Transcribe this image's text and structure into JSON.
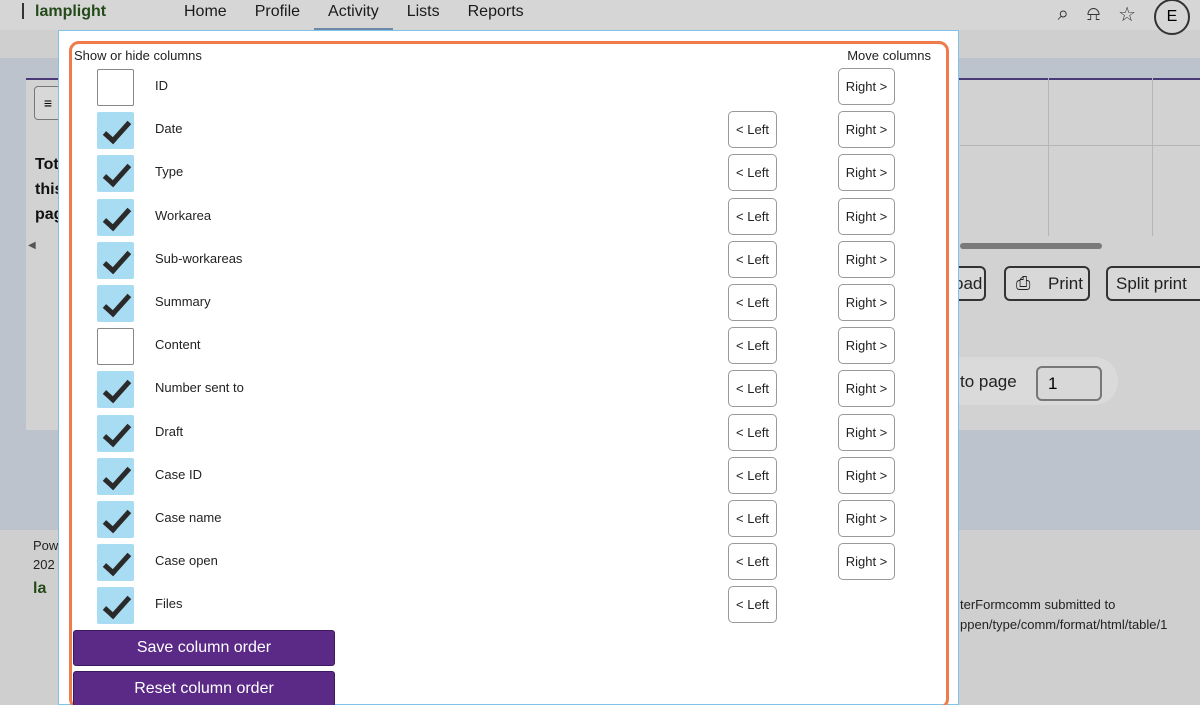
{
  "app": {
    "logo_text": "lamplight",
    "nav": [
      "Home",
      "Profile",
      "Activity",
      "Lists",
      "Reports"
    ],
    "avatar_initial": "E"
  },
  "background": {
    "left_text_lines": [
      "Tot",
      "this",
      "pag"
    ],
    "buttons": {
      "download": "oad",
      "print": "Print",
      "split_print": "Split print"
    },
    "pager": {
      "label": "to page",
      "value": "1"
    },
    "footer": {
      "powered": "Pow",
      "year": "202",
      "logo": "la",
      "message_line1": "terFormcomm submitted to",
      "message_line2": "ppen/type/comm/format/html/table/1"
    }
  },
  "dialog": {
    "show_hide_label": "Show or hide columns",
    "move_label": "Move columns",
    "left_button_label": "< Left",
    "right_button_label": "Right >",
    "columns": [
      {
        "name": "ID",
        "checked": false,
        "has_left": false,
        "has_right": true
      },
      {
        "name": "Date",
        "checked": true,
        "has_left": true,
        "has_right": true
      },
      {
        "name": "Type",
        "checked": true,
        "has_left": true,
        "has_right": true
      },
      {
        "name": "Workarea",
        "checked": true,
        "has_left": true,
        "has_right": true
      },
      {
        "name": "Sub-workareas",
        "checked": true,
        "has_left": true,
        "has_right": true
      },
      {
        "name": "Summary",
        "checked": true,
        "has_left": true,
        "has_right": true
      },
      {
        "name": "Content",
        "checked": false,
        "has_left": true,
        "has_right": true
      },
      {
        "name": "Number sent to",
        "checked": true,
        "has_left": true,
        "has_right": true
      },
      {
        "name": "Draft",
        "checked": true,
        "has_left": true,
        "has_right": true
      },
      {
        "name": "Case ID",
        "checked": true,
        "has_left": true,
        "has_right": true
      },
      {
        "name": "Case name",
        "checked": true,
        "has_left": true,
        "has_right": true
      },
      {
        "name": "Case open",
        "checked": true,
        "has_left": true,
        "has_right": true
      },
      {
        "name": "Files",
        "checked": true,
        "has_left": true,
        "has_right": false
      }
    ],
    "save_label": "Save column order",
    "reset_label": "Reset column order"
  },
  "colors": {
    "accent_purple": "#5b2a86",
    "checkbox_checked": "#a8dcf2",
    "focus_outline": "#ef7b4a"
  }
}
